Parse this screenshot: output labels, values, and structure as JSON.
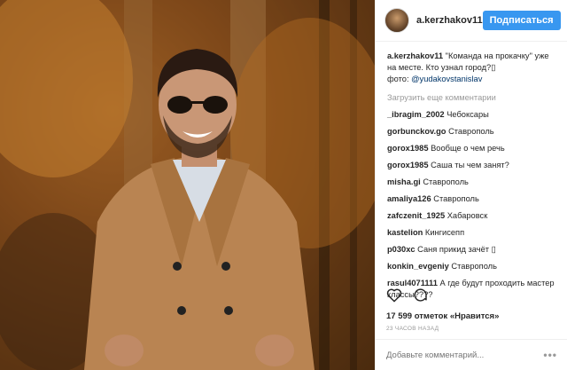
{
  "post": {
    "username": "a.kerzhakov11",
    "follow_label": "Подписаться",
    "caption": {
      "user": "a.kerzhakov11",
      "text": "\"Команда на прокачку\" уже на месте. Кто узнал город?",
      "photo_credit_prefix": "фото: ",
      "mention": "@yudakovstanislav"
    },
    "load_more": "Загрузить еще комментарии",
    "comments": [
      {
        "user": "_ibragim_2002",
        "text": "Чебоксары"
      },
      {
        "user": "gorbunckov.go",
        "text": "Ставрополь"
      },
      {
        "user": "gorox1985",
        "text": "Вообще о чем речь"
      },
      {
        "user": "gorox1985",
        "text": "Саша ты чем занят?"
      },
      {
        "user": "misha.gi",
        "text": "Ставрополь"
      },
      {
        "user": "amaliya126",
        "text": "Ставрополь"
      },
      {
        "user": "zafczenit_1925",
        "text": "Хабаровск"
      },
      {
        "user": "kastelion",
        "text": "Кингисепп"
      },
      {
        "user": "p030xc",
        "text": "Саня прикид зачёт"
      },
      {
        "user": "konkin_evgeniy",
        "text": "Ставрополь"
      },
      {
        "user": "rasul4071111",
        "text": "А где будут проходить мастер классы????"
      }
    ],
    "likes": "17 599 отметок «Нравится»",
    "timestamp": "23 ЧАСОВ НАЗАД",
    "comment_placeholder": "Добавьте комментарий...",
    "more_options": "•••"
  },
  "icons": {
    "like": "heart-icon",
    "comment": "speech-bubble-icon",
    "more": "more-options-icon"
  },
  "colors": {
    "follow_button": "#3897f0",
    "mention": "#003569",
    "muted_text": "#999999"
  }
}
